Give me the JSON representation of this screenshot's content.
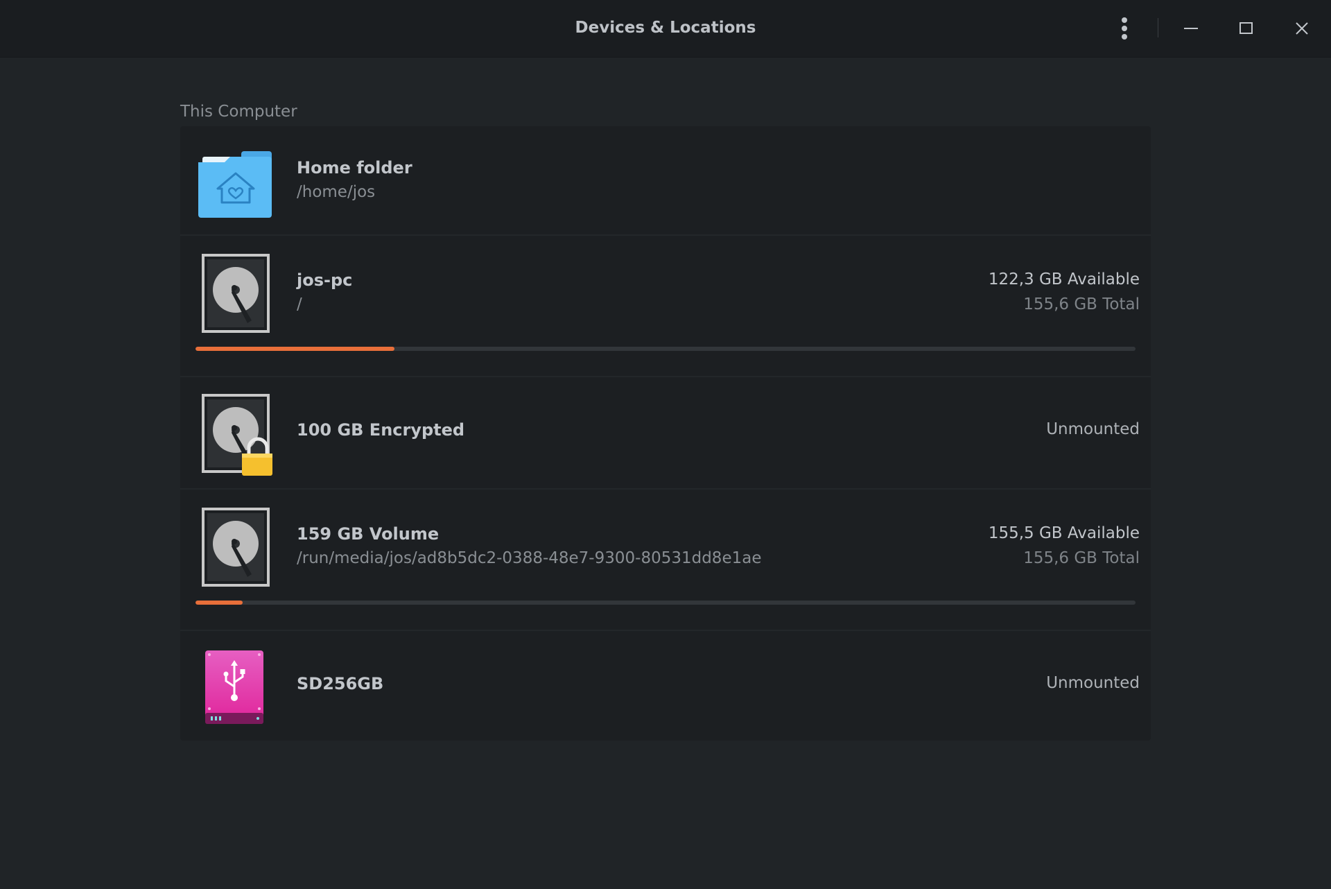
{
  "window": {
    "title": "Devices & Locations"
  },
  "section": {
    "label": "This Computer"
  },
  "items": [
    {
      "name": "Home folder",
      "path": "/home/jos",
      "icon": "home-folder-icon"
    },
    {
      "name": "jos-pc",
      "path": "/",
      "available": "122,3 GB Available",
      "total": "155,6 GB Total",
      "usage_fraction": 0.212,
      "icon": "hard-disk-icon"
    },
    {
      "name": "100 GB Encrypted",
      "status": "Unmounted",
      "icon": "encrypted-disk-icon"
    },
    {
      "name": "159 GB Volume",
      "path": "/run/media/jos/ad8b5dc2-0388-48e7-9300-80531dd8e1ae",
      "available": "155,5 GB Available",
      "total": "155,6 GB Total",
      "usage_fraction": 0.05,
      "icon": "hard-disk-icon"
    },
    {
      "name": "SD256GB",
      "status": "Unmounted",
      "icon": "usb-drive-icon"
    }
  ],
  "colors": {
    "accent": "#e86f3a",
    "folder": "#5bbcf5",
    "usb": "#e0249a",
    "lock": "#f5c02e"
  }
}
